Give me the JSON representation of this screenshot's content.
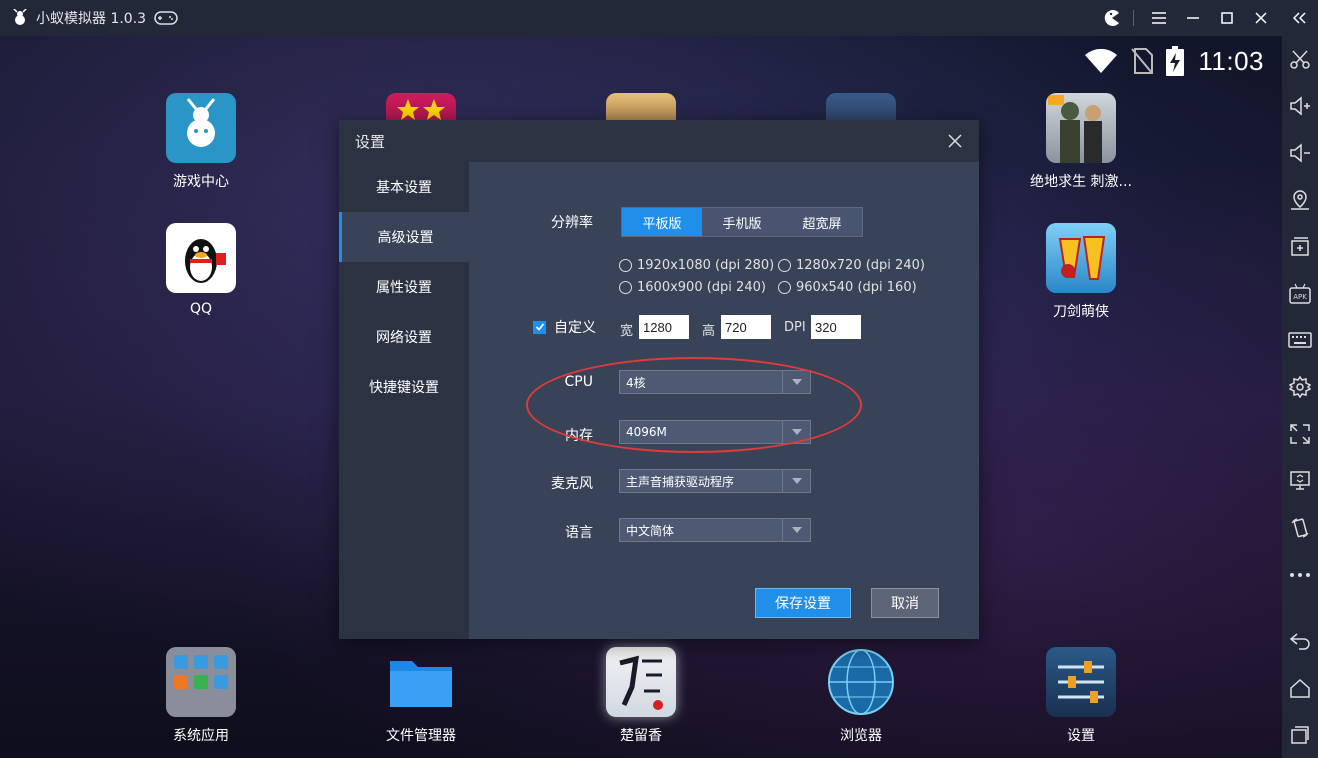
{
  "window": {
    "title": "小蚁模拟器 1.0.3"
  },
  "status": {
    "time": "11:03"
  },
  "desktop": {
    "apps_top": [
      {
        "label": "游戏中心"
      },
      {
        "label": "QQ"
      },
      {
        "label": "绝地求生 刺激..."
      },
      {
        "label": "刀剑萌侠"
      }
    ],
    "dock": [
      {
        "label": "系统应用"
      },
      {
        "label": "文件管理器"
      },
      {
        "label": "楚留香"
      },
      {
        "label": "浏览器"
      },
      {
        "label": "设置"
      }
    ]
  },
  "dialog": {
    "title": "设置",
    "nav": [
      {
        "label": "基本设置"
      },
      {
        "label": "高级设置"
      },
      {
        "label": "属性设置"
      },
      {
        "label": "网络设置"
      },
      {
        "label": "快捷键设置"
      }
    ],
    "resolution": {
      "label": "分辨率",
      "modes": [
        "平板版",
        "手机版",
        "超宽屏"
      ],
      "options": [
        "1920x1080 (dpi 280)",
        "1280x720 (dpi 240)",
        "1600x900 (dpi 240)",
        "960x540 (dpi 160)"
      ],
      "custom_label": "自定义",
      "width_label": "宽",
      "width_value": "1280",
      "height_label": "高",
      "height_value": "720",
      "dpi_label": "DPI",
      "dpi_value": "320"
    },
    "cpu": {
      "label": "CPU",
      "value": "4核"
    },
    "memory": {
      "label": "内存",
      "value": "4096M"
    },
    "microphone": {
      "label": "麦克风",
      "value": "主声音捕获驱动程序"
    },
    "language": {
      "label": "语言",
      "value": "中文简体"
    },
    "save_label": "保存设置",
    "cancel_label": "取消"
  }
}
